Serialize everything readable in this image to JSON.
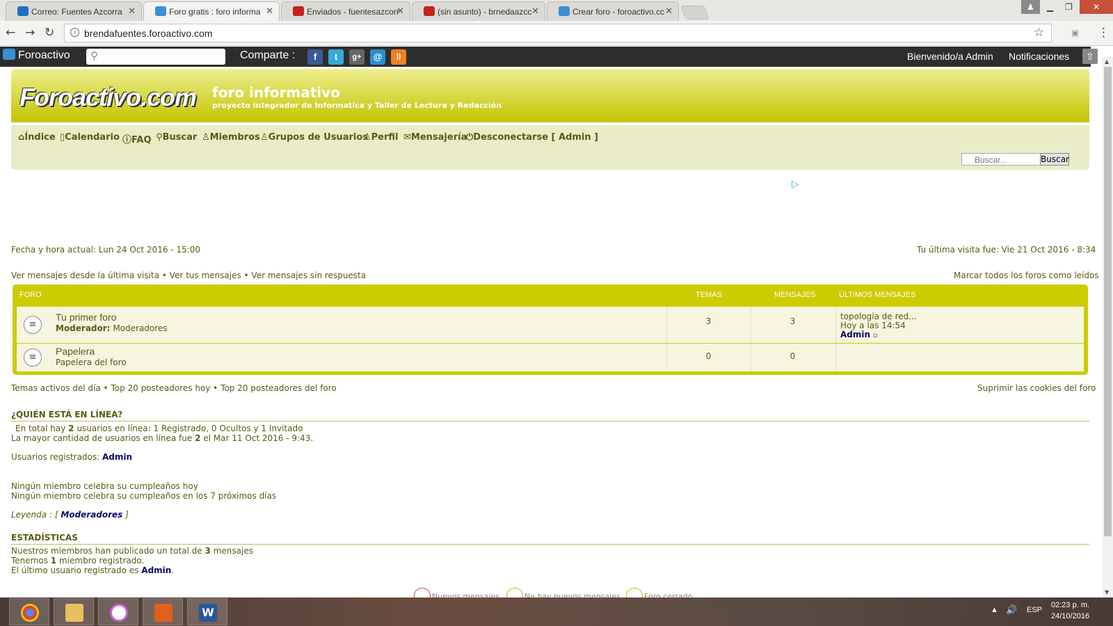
{
  "browser": {
    "tabs": [
      {
        "title": "Correo: Fuentes Azcorra",
        "color": "#1f6fc2"
      },
      {
        "title": "Foro gratis : foro informa",
        "color": "#3b8fd5"
      },
      {
        "title": "Enviados - fuentesazcorr",
        "color": "#c5221f"
      },
      {
        "title": "(sin asunto) - brnedaazcc",
        "color": "#c5221f"
      },
      {
        "title": "Crear foro - foroactivo.cc",
        "color": "#3b8fd5"
      }
    ],
    "url": "brendafuentes.foroactivo.com"
  },
  "topbar": {
    "logo": "Foroactivo",
    "share_label": "Comparte :",
    "share_icons": [
      {
        "name": "facebook-icon",
        "glyph": "f",
        "color": "#3b5998"
      },
      {
        "name": "twitter-icon",
        "glyph": "t",
        "color": "#33aadd"
      },
      {
        "name": "google-plus-icon",
        "glyph": "g+",
        "color": "#666"
      },
      {
        "name": "email-icon",
        "glyph": "@",
        "color": "#2a8fd0"
      },
      {
        "name": "rss-icon",
        "glyph": "))",
        "color": "#f08020"
      }
    ],
    "welcome": "Bienvenido/a Admin",
    "notifications": "Notificaciones"
  },
  "header": {
    "brand": "Foroactivo.com",
    "title": "foro informativo",
    "description": "proyecto integrador de Informatica y Taller de Lectura y Redacción"
  },
  "menu": {
    "items": [
      {
        "label": "Índice",
        "icon": "home-icon",
        "glyph": "⌂"
      },
      {
        "label": "Calendario",
        "icon": "calendar-icon",
        "glyph": "1"
      },
      {
        "label": "FAQ",
        "icon": "faq-icon",
        "glyph": "?"
      },
      {
        "label": "Buscar",
        "icon": "search-icon",
        "glyph": "⚲"
      },
      {
        "label": "Miembros",
        "icon": "members-icon",
        "glyph": "♙"
      },
      {
        "label": "Grupos de Usuarios",
        "icon": "groups-icon",
        "glyph": "♙"
      },
      {
        "label": "Perfil",
        "icon": "profile-icon",
        "glyph": "♙"
      },
      {
        "label": "Mensajería",
        "icon": "mail-icon",
        "glyph": "✉"
      },
      {
        "label": "Desconectarse [ Admin ]",
        "icon": "logout-icon",
        "glyph": "⏻"
      }
    ],
    "search_placeholder": "Buscar...",
    "search_button": "Buscar"
  },
  "info": {
    "current_time": "Fecha y hora actual: Lun 24 Oct 2016 - 15:00",
    "last_visit": "Tu última visita fue: Vie 21 Oct 2016 - 8:34",
    "links_left": "Ver mensajes desde la última visita • Ver tus mensajes • Ver mensajes sin respuesta",
    "mark_read": "Marcar todos los foros como leídos"
  },
  "forum_table": {
    "headers": {
      "forum": "FORO",
      "topics": "TEMAS",
      "posts": "MENSAJES",
      "last": "ÚLTIMOS MENSAJES"
    },
    "rows": [
      {
        "name": "Tu primer foro",
        "sub_label": "Moderador:",
        "sub": "Moderadores",
        "topics": "3",
        "posts": "3",
        "last_title": "topologia de red...",
        "last_time": "Hoy a las 14:54",
        "last_user": "Admin"
      },
      {
        "name": "Papelera",
        "sub_label": "",
        "sub": "Papelera del foro",
        "topics": "0",
        "posts": "0",
        "last_title": "",
        "last_time": "",
        "last_user": ""
      }
    ]
  },
  "bottom_links": {
    "left": "Temas activos del día • Top 20 posteadores hoy • Top 20 posteadores del foro",
    "right": "Suprimir las cookies del foro"
  },
  "online": {
    "heading": "¿QUIÉN ESTÁ EN LÍNEA?",
    "line1_a": "En total hay",
    "line1_num": "2",
    "line1_b": "usuarios en línea: 1 Registrado, 0 Ocultos y 1 Invitado",
    "line2_a": "La mayor cantidad de usuarios en línea fue",
    "line2_num": "2",
    "line2_b": "el Mar 11 Oct 2016 - 9:43.",
    "registered_label": "Usuarios registrados:",
    "registered_user": "Admin",
    "birthday_today": "Ningún miembro celebra su cumpleaños hoy",
    "birthday_week": "Ningún miembro celebra su cumpleaños en los 7 próximos días",
    "legend_label": "Leyenda :",
    "legend_open": "[",
    "legend_value": "Moderadores",
    "legend_close": "]"
  },
  "stats": {
    "heading": "ESTADÍSTICAS",
    "l1_a": "Nuestros miembros han publicado un total de",
    "l1_num": "3",
    "l1_b": "mensajes",
    "l2_a": "Tenemos",
    "l2_num": "1",
    "l2_b": "miembro registrado.",
    "l3_a": "El último usuario registrado es",
    "l3_user": "Admin"
  },
  "legend_icons": [
    "Nuevos mensajes",
    "No hay nuevos mensajes",
    "Foro cerrado"
  ],
  "taskbar": {
    "apps": [
      {
        "name": "chrome-icon",
        "color": "#dd4433"
      },
      {
        "name": "file-explorer-icon",
        "color": "#e8c060"
      },
      {
        "name": "itunes-icon",
        "color": "#c860d8"
      },
      {
        "name": "office-icon",
        "color": "#e06020"
      },
      {
        "name": "word-icon",
        "color": "#2b5797"
      }
    ],
    "lang": "ESP",
    "time": "02:23 p. m.",
    "date": "24/10/2016"
  }
}
